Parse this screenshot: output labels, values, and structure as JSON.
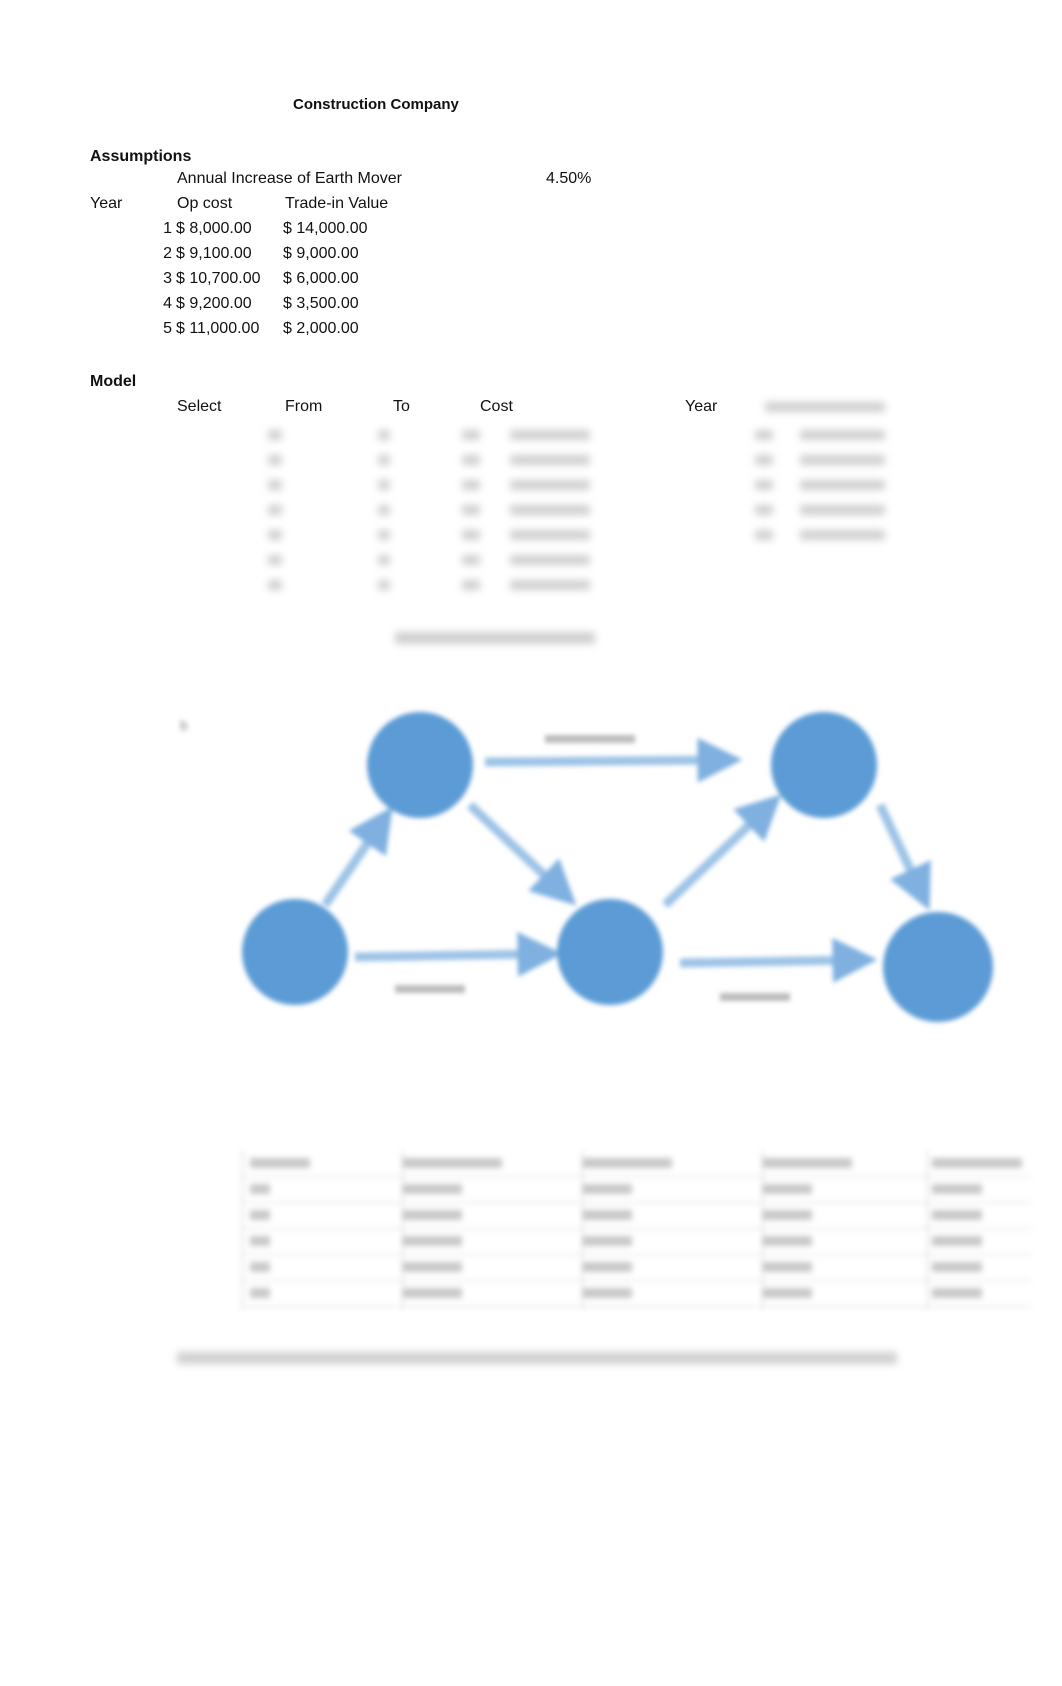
{
  "document": {
    "title": "Construction Company"
  },
  "assumptions": {
    "heading": "Assumptions",
    "annual_increase_label": "Annual Increase of Earth Mover",
    "annual_increase_value": "4.50%",
    "headers": {
      "year": "Year",
      "op_cost": "Op cost",
      "trade_in": "Trade-in Value"
    },
    "rows": [
      {
        "year": "1",
        "op_cost": "$    8,000.00",
        "trade_in": "$  14,000.00"
      },
      {
        "year": "2",
        "op_cost": "$    9,100.00",
        "trade_in": "$     9,000.00"
      },
      {
        "year": "3",
        "op_cost": "$ 10,700.00",
        "trade_in": "$     6,000.00"
      },
      {
        "year": "4",
        "op_cost": "$    9,200.00",
        "trade_in": "$     3,500.00"
      },
      {
        "year": "5",
        "op_cost": "$ 11,000.00",
        "trade_in": "$     2,000.00"
      }
    ]
  },
  "model": {
    "heading": "Model",
    "headers": {
      "select": "Select",
      "from": "From",
      "to": "To",
      "cost": "Cost",
      "year": "Year"
    }
  },
  "diagram": {
    "node_color": "#5B9BD5",
    "arrow_color": "#9DC3E6"
  }
}
